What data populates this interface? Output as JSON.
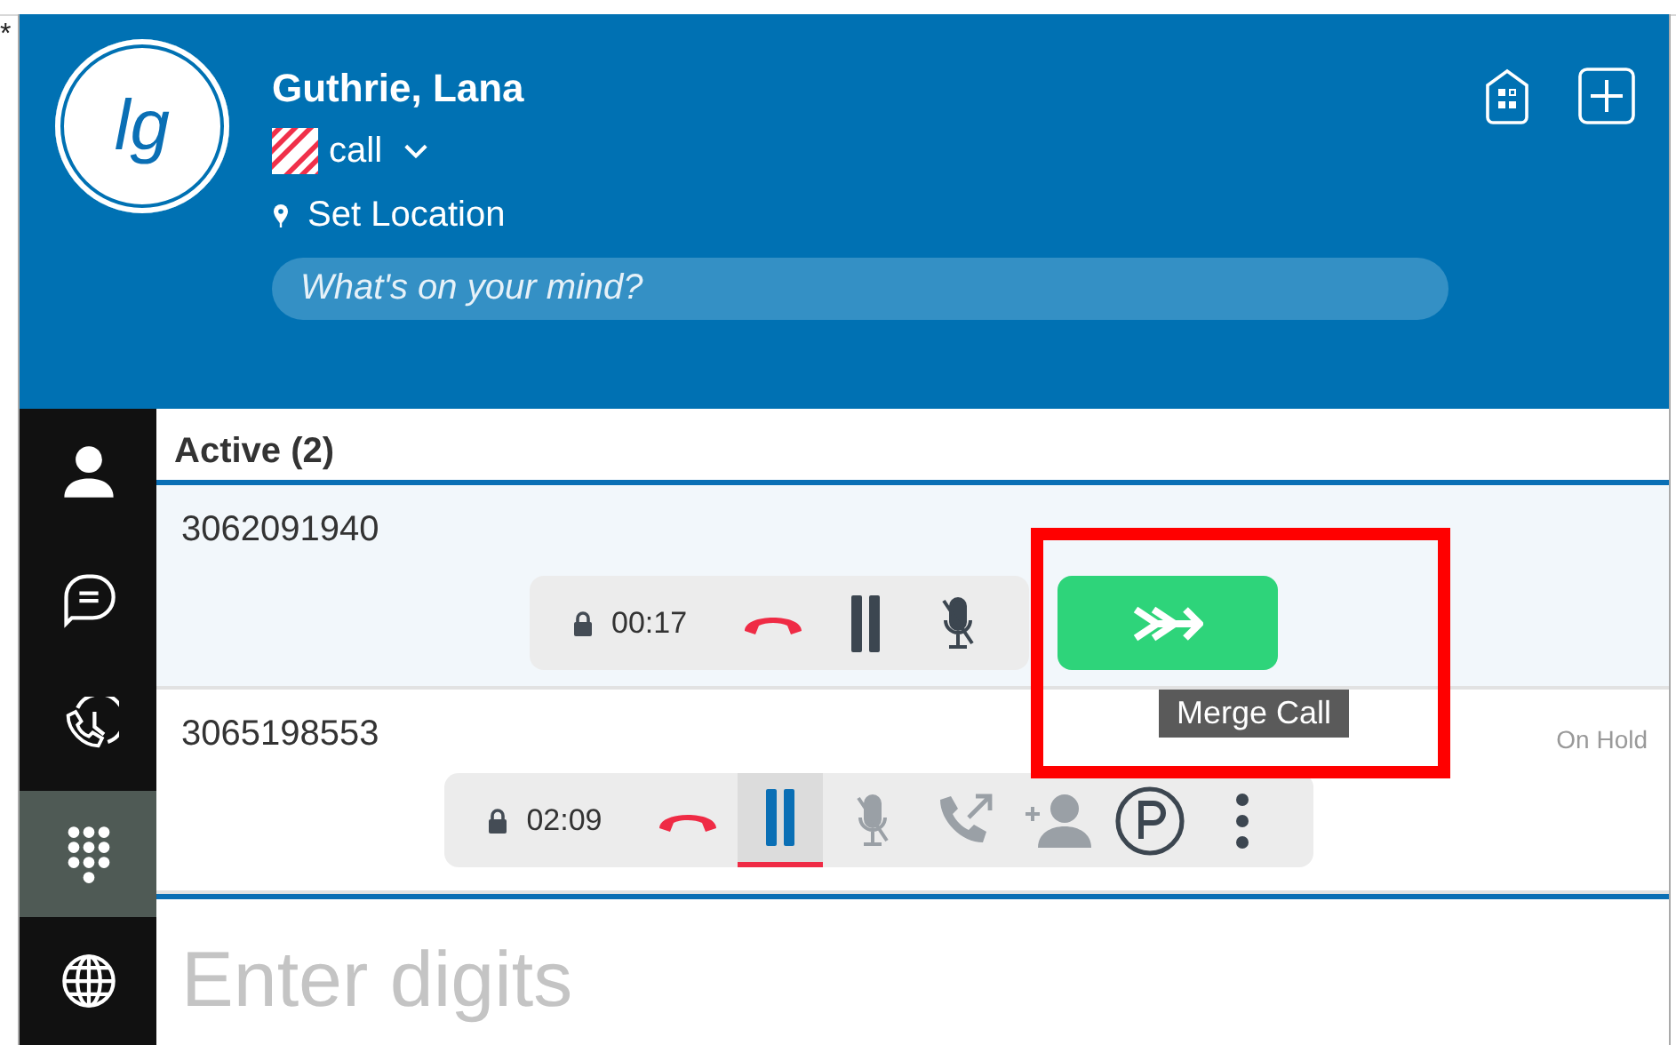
{
  "backdrop_mark": "*",
  "header": {
    "avatar": "lg",
    "name": "Guthrie, Lana",
    "status": "call",
    "location": "Set Location",
    "mind_placeholder": "What's on your mind?"
  },
  "sidebar": {
    "items": [
      {
        "kind": "person",
        "selected": false
      },
      {
        "kind": "chat",
        "selected": false
      },
      {
        "kind": "history",
        "selected": false
      },
      {
        "kind": "dialpad",
        "selected": true
      },
      {
        "kind": "globe",
        "selected": false
      }
    ]
  },
  "calls_heading": "Active (2)",
  "calls": [
    {
      "number": "3062091940",
      "selected": true,
      "timer": "00:17",
      "controls": [
        {
          "kind": "hangup",
          "selected": false
        },
        {
          "kind": "hold",
          "selected": false
        },
        {
          "kind": "mute",
          "selected": false
        },
        {
          "kind": "merge",
          "selected": false
        }
      ]
    },
    {
      "number": "3065198553",
      "selected": false,
      "state": "On Hold",
      "timer": "02:09",
      "controls": [
        {
          "kind": "hangup",
          "selected": false
        },
        {
          "kind": "hold",
          "selected": true
        },
        {
          "kind": "mute",
          "selected": false
        },
        {
          "kind": "transfer",
          "selected": false
        },
        {
          "kind": "add",
          "selected": false
        },
        {
          "kind": "park",
          "selected": false
        },
        {
          "kind": "more",
          "selected": false
        }
      ]
    }
  ],
  "tooltip": "Merge Call",
  "dial_placeholder": "Enter digits"
}
